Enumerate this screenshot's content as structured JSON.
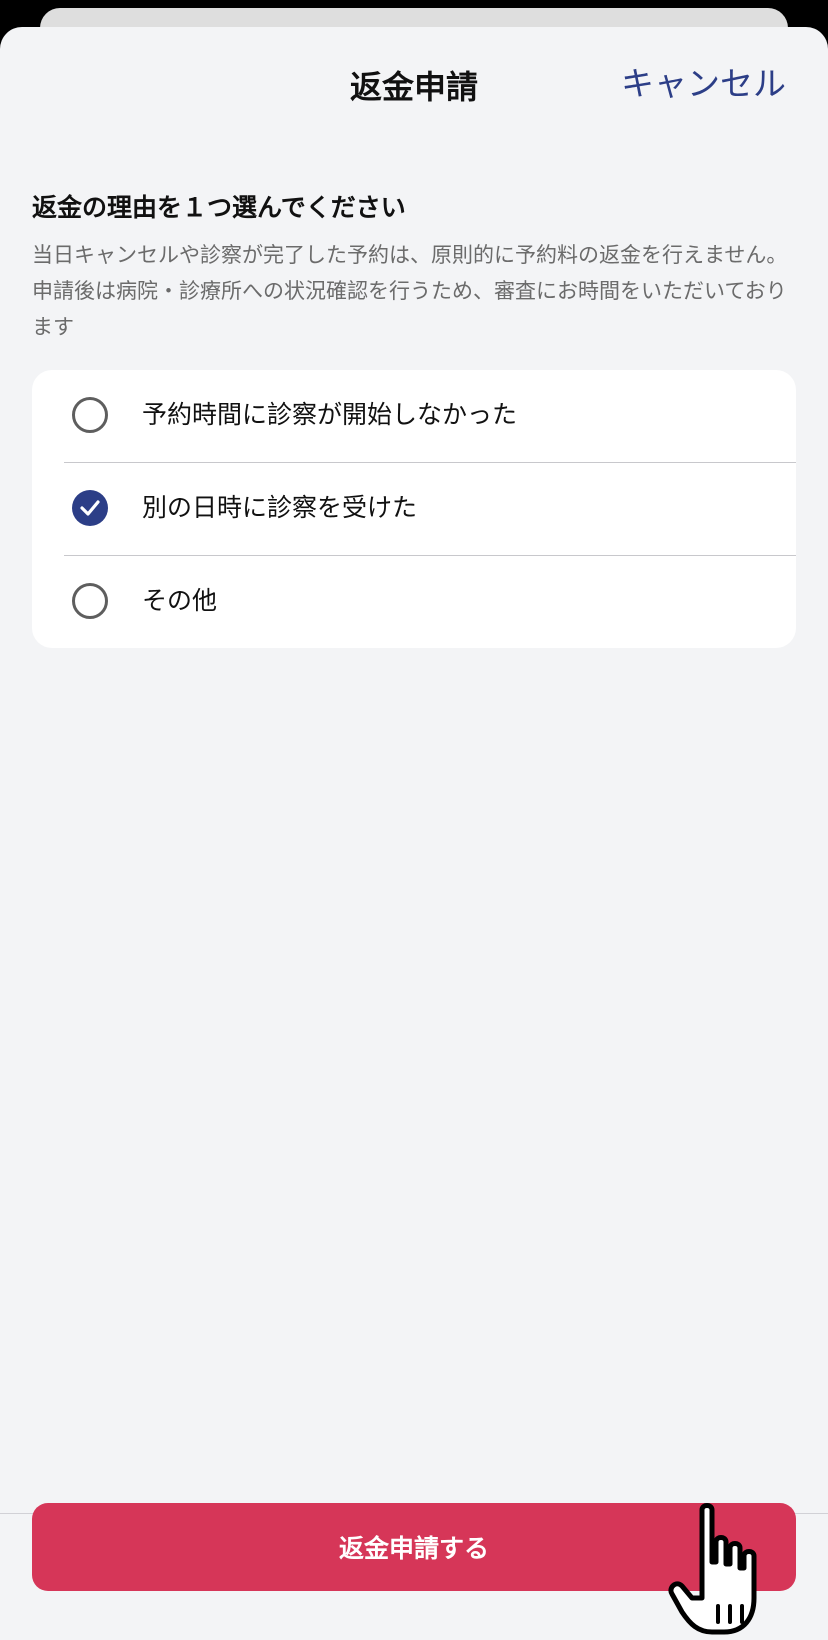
{
  "header": {
    "title": "返金申請",
    "cancel_label": "キャンセル"
  },
  "section": {
    "heading": "返金の理由を１つ選んでください",
    "description": "当日キャンセルや診察が完了した予約は、原則的に予約料の返金を行えません。申請後は病院・診療所への状況確認を行うため、審査にお時間をいただいております"
  },
  "options": [
    {
      "label": "予約時間に診察が開始しなかった",
      "selected": false
    },
    {
      "label": "別の日時に診察を受けた",
      "selected": true
    },
    {
      "label": "その他",
      "selected": false
    }
  ],
  "footer": {
    "submit_label": "返金申請する"
  },
  "colors": {
    "accent": "#2c3e87",
    "submit": "#d63658",
    "background": "#f3f4f6"
  },
  "icons": {
    "cursor": "hand-pointer-icon",
    "check": "checkmark-icon"
  }
}
